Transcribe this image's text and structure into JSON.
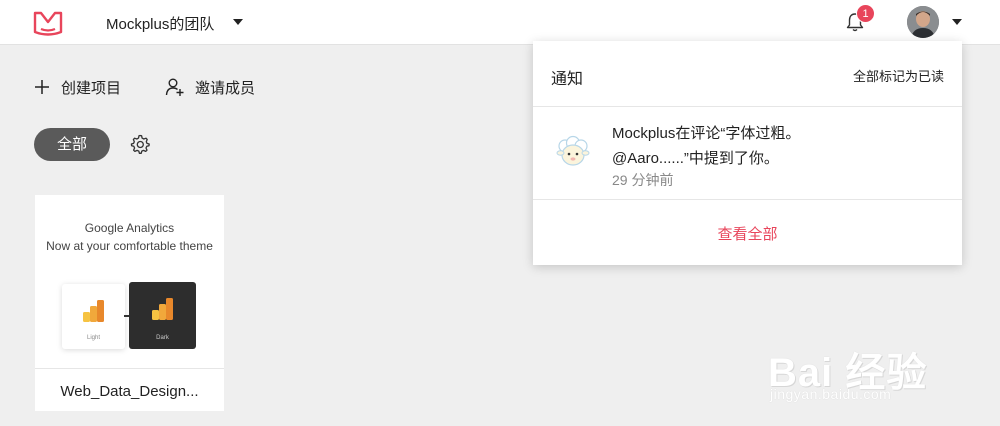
{
  "header": {
    "team_name": "Mockplus的团队",
    "notification_count": "1",
    "colors": {
      "brand": "#e8455b",
      "badge": "#e8455b"
    }
  },
  "actions": {
    "create_label": "创建项目",
    "invite_label": "邀请成员"
  },
  "filter": {
    "all_label": "全部"
  },
  "project_card": {
    "thumb_line1": "Google Analytics",
    "thumb_line2": "Now at your comfortable theme",
    "light_label": "Light",
    "dark_label": "Dark",
    "name": "Web_Data_Design..."
  },
  "notifications": {
    "title": "通知",
    "mark_all_read": "全部标记为已读",
    "items": [
      {
        "line1": "Mockplus在评论“字体过粗。",
        "line2": "@Aaro......”中提到了你。",
        "time": "29 分钟前"
      }
    ],
    "view_all": "查看全部"
  },
  "watermark": {
    "text": "Bai 经验",
    "url": "jingyan.baidu.com"
  },
  "icons": [
    "logo-icon",
    "caret-down-icon",
    "bell-icon",
    "avatar",
    "plus-icon",
    "add-user-icon",
    "gear-icon",
    "chart-icon",
    "sheep-avatar-icon"
  ]
}
